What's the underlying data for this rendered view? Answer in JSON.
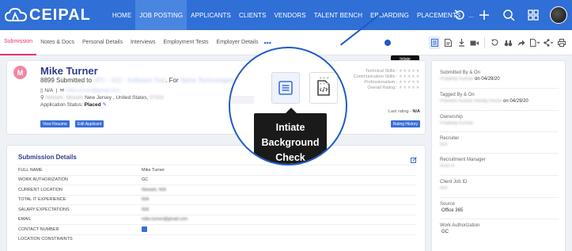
{
  "brand": {
    "name": "CEIPAL",
    "color": "#2f6fd6",
    "accent": "#e8336b"
  },
  "nav": {
    "menu": [
      {
        "label": "HOME",
        "active": false
      },
      {
        "label": "JOB POSTING",
        "active": true
      },
      {
        "label": "APPLICANTS",
        "active": false
      },
      {
        "label": "CLIENTS",
        "active": false
      },
      {
        "label": "VENDORS",
        "active": false
      },
      {
        "label": "TALENT BENCH",
        "active": false
      },
      {
        "label": "EBOARDING",
        "active": false
      },
      {
        "label": "PLACEMENTS",
        "active": false
      },
      {
        "label": "...",
        "active": false
      }
    ],
    "icons": [
      "history-icon",
      "plus-icon",
      "search-icon",
      "grid-icon",
      "user-avatar"
    ]
  },
  "tabs": [
    {
      "label": "Submission",
      "active": true
    },
    {
      "label": "Notes & Docs",
      "active": false
    },
    {
      "label": "Personal Details",
      "active": false
    },
    {
      "label": "Interviews",
      "active": false
    },
    {
      "label": "Employment Tests",
      "active": false
    },
    {
      "label": "Employer Details",
      "active": false
    }
  ],
  "tabs_more": "•••",
  "toolbar_icons": [
    "background-check-icon",
    "document-icon",
    "download-icon",
    "video-icon",
    "history-icon",
    "binoculars-icon",
    "forward-icon",
    "document-menu-icon",
    "share-icon",
    "print-icon"
  ],
  "tooltip_small": "Intiate Background Check",
  "profile": {
    "initial": "M",
    "name": "Mike Turner",
    "sub_prefix": "8899 Submitted to",
    "job_ref": "JPC - 422 - Software Test",
    "for_text": "For",
    "client": "Alpha Technologies",
    "phone": "N/A",
    "email": "mike.turner@gmail.com",
    "location_blur": "Newark, Newark",
    "location": "New Jersey , United States,",
    "zip": "07101",
    "status_label": "Application Status:",
    "status_value": "Placed",
    "buttons": [
      "View Resume",
      "Edit Applicant"
    ],
    "skills": [
      {
        "label": "Technical Skills :",
        "stars": "★★★★★"
      },
      {
        "label": "Communication Skills :",
        "stars": "★★★★★"
      },
      {
        "label": "Professionalism :",
        "stars": "★★★★★"
      },
      {
        "label": "Overall Rating :",
        "stars": "★★★★★"
      }
    ],
    "last_rating_label": "Last rating -",
    "last_rating_value": "N/A",
    "rating_history": "Rating History"
  },
  "submission": {
    "title": "Submission Details",
    "rows": [
      {
        "label": "FULL NAME",
        "value": "Mike Turner",
        "blur": false
      },
      {
        "label": "WORK AUTHORIZATION",
        "value": "GC",
        "blur": false
      },
      {
        "label": "CURRENT LOCATION",
        "value": "Newark, N/A",
        "blur": true
      },
      {
        "label": "TOTAL IT EXPERIENCE",
        "value": "N/A",
        "blur": true
      },
      {
        "label": "SALARY EXPECTATIONS",
        "value": "N/A",
        "blur": true
      },
      {
        "label": "EMAIL",
        "value": "mike.turner@gmail.com",
        "blur": true
      },
      {
        "label": "CONTACT NUMBER",
        "value": "",
        "blur": false
      },
      {
        "label": "LOCATION CONSTRAINTS",
        "value": "",
        "blur": false
      }
    ]
  },
  "right_panel": [
    {
      "label": "Submitted By & On",
      "value_blur": "Pradeep Kumar",
      "value": "on 04/29/20"
    },
    {
      "label": "Tagged By & On",
      "value_blur": "Praveen Kumar Reddy Kesra",
      "value": "on 04/29/20"
    },
    {
      "label": "Ownership",
      "value_blur": "Pradeep Kumar",
      "value": ""
    },
    {
      "label": "Recruiter",
      "value_blur": "N/A",
      "value": ""
    },
    {
      "label": "Recruitment Manager",
      "value_blur": "Arun R",
      "value": ""
    },
    {
      "label": "Client Job ID",
      "value_blur": "N/A",
      "value": ""
    },
    {
      "label": "Source",
      "value_blur": "",
      "value": "Office 365"
    },
    {
      "label": "Work Authorization",
      "value_blur": "",
      "value": "GC"
    }
  ],
  "magnifier": {
    "tooltip_lines": [
      "Intiate",
      "Background",
      "Check"
    ]
  }
}
